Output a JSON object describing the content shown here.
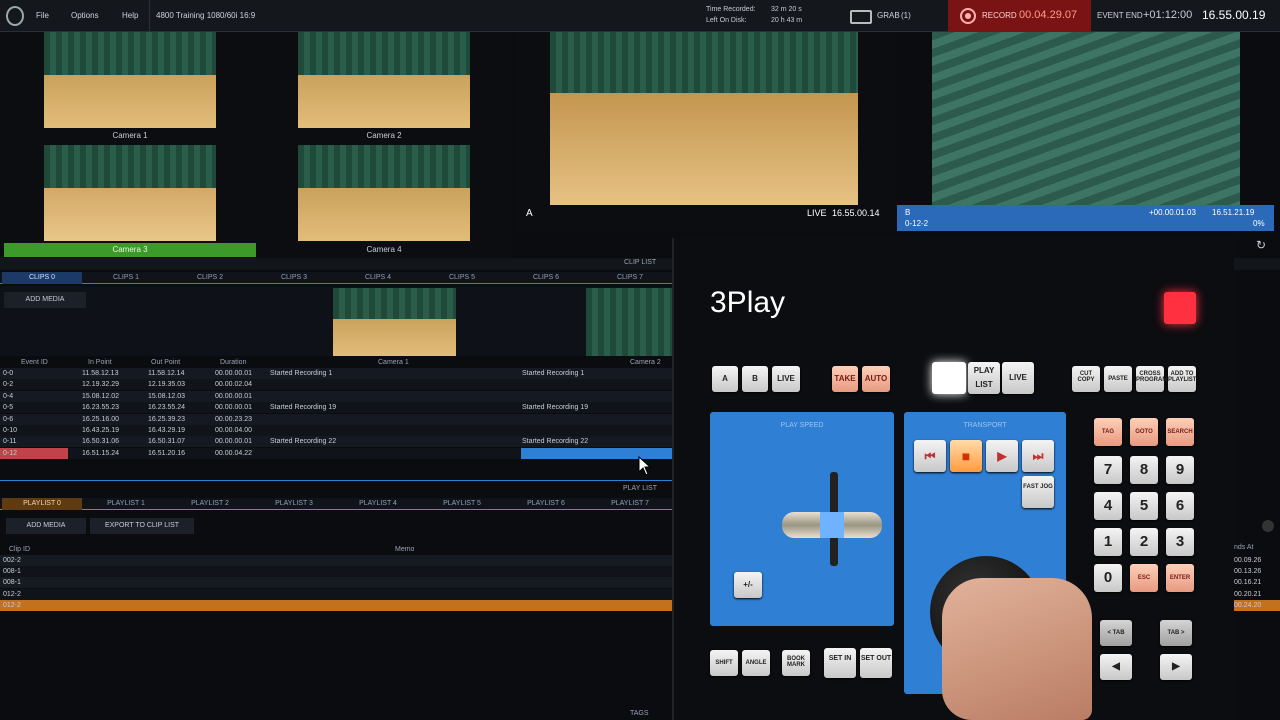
{
  "menu": {
    "file": "File",
    "options": "Options",
    "help": "Help",
    "session": "4800 Training 1080/60i 16:9"
  },
  "status": {
    "time_recorded_label": "Time Recorded:",
    "time_recorded": "32 m 20 s",
    "left_on_disk_label": "Left On Disk:",
    "left_on_disk": "20 h 43 m",
    "grab_label": "GRAB",
    "grab_count": "(1)",
    "record_label": "RECORD",
    "record_time": "00.04.29.07",
    "event_end_label": "EVENT END",
    "event_end_offset": "+01:12:00",
    "event_end_time": "16.55.00.19"
  },
  "cameras": [
    {
      "label": "Camera 1"
    },
    {
      "label": "Camera 2"
    },
    {
      "label": "Camera 3"
    },
    {
      "label": "Camera 4"
    }
  ],
  "program": {
    "a_label": "A",
    "live_label": "LIVE",
    "live_time": "16.55.00.14"
  },
  "preview": {
    "b_label": "B",
    "clip": "0-12-2",
    "offset": "+00.00.01.03",
    "time": "16.51.21.19",
    "percent": "0%"
  },
  "clip_list": {
    "title": "CLIP LIST",
    "tabs": [
      "CLIPS 0",
      "CLIPS 1",
      "CLIPS 2",
      "CLIPS 3",
      "CLIPS 4",
      "CLIPS 5",
      "CLIPS 6",
      "CLIPS 7"
    ],
    "add_media": "ADD MEDIA",
    "thumb_labels": [
      "Camera 1",
      "Camera 2"
    ],
    "headers": [
      "Event ID",
      "In Point",
      "Out Point",
      "Duration"
    ],
    "rows": [
      {
        "id": "0-0",
        "in": "11.58.12.13",
        "out": "11.58.12.14",
        "dur": "00.00.00.01",
        "cam1": "Started Recording 1",
        "cam2": "Started Recording 1"
      },
      {
        "id": "0-2",
        "in": "12.19.32.29",
        "out": "12.19.35.03",
        "dur": "00.00.02.04",
        "cam1": "",
        "cam2": ""
      },
      {
        "id": "0-4",
        "in": "15.08.12.02",
        "out": "15.08.12.03",
        "dur": "00.00.00.01",
        "cam1": "",
        "cam2": ""
      },
      {
        "id": "0-5",
        "in": "16.23.55.23",
        "out": "16.23.55.24",
        "dur": "00.00.00.01",
        "cam1": "Started Recording 19",
        "cam2": "Started Recording 19"
      },
      {
        "id": "0-6",
        "in": "16.25.16.00",
        "out": "16.25.39.23",
        "dur": "00.00.23.23",
        "cam1": "",
        "cam2": ""
      },
      {
        "id": "0-10",
        "in": "16.43.25.19",
        "out": "16.43.29.19",
        "dur": "00.00.04.00",
        "cam1": "",
        "cam2": ""
      },
      {
        "id": "0-11",
        "in": "16.50.31.06",
        "out": "16.50.31.07",
        "dur": "00.00.00.01",
        "cam1": "Started Recording 22",
        "cam2": "Started Recording 22"
      },
      {
        "id": "0-12",
        "in": "16.51.15.24",
        "out": "16.51.20.16",
        "dur": "00.00.04.22",
        "cam1": "",
        "cam2": ""
      }
    ]
  },
  "play_list": {
    "title": "PLAY LIST",
    "tabs": [
      "PLAYLIST 0",
      "PLAYLIST 1",
      "PLAYLIST 2",
      "PLAYLIST 3",
      "PLAYLIST 4",
      "PLAYLIST 5",
      "PLAYLIST 6",
      "PLAYLIST 7"
    ],
    "add_media": "ADD MEDIA",
    "export": "EXPORT TO CLIP LIST",
    "headers": [
      "Clip ID",
      "Memo"
    ],
    "rows": [
      "002-2",
      "008-1",
      "008-1",
      "012-2",
      "012-2"
    ],
    "ends_header": "nds At",
    "ends": [
      "00.09.26",
      "00.13.26",
      "00.16.21",
      "00.20.21",
      "00.24.20"
    ]
  },
  "tags_label": "TAGS",
  "controller": {
    "brand": "3Play",
    "keys_ab": [
      "A",
      "B",
      "LIVE"
    ],
    "keys_take": [
      "TAKE",
      "AUTO"
    ],
    "keys_play": [
      "",
      "PLAY LIST",
      "LIVE"
    ],
    "keys_edit": [
      "CUT COPY",
      "PASTE",
      "CROSS PROGRAM",
      "ADD TO PLAYLIST"
    ],
    "play_speed": "PLAY SPEED",
    "transport": "TRANSPORT",
    "fast_jog": "FAST JOG",
    "plus_minus": "+/-",
    "keys_func": [
      "TAG",
      "GOTO",
      "SEARCH"
    ],
    "keypad": [
      "7",
      "8",
      "9",
      "4",
      "5",
      "6",
      "1",
      "2",
      "3",
      "0",
      "ESC",
      "ENTER"
    ],
    "keys_bottom": [
      "SHIFT",
      "ANGLE",
      "BOOK MARK",
      "SET IN",
      "SET OUT"
    ],
    "keys_tab": [
      "< TAB",
      "TAB >"
    ]
  },
  "colors": {
    "accent": "#2f7fd4",
    "record": "#7a1414",
    "selected_row": "#c0424a",
    "play_selected": "#c2711c",
    "camera3_tally": "#3c9a2a"
  }
}
